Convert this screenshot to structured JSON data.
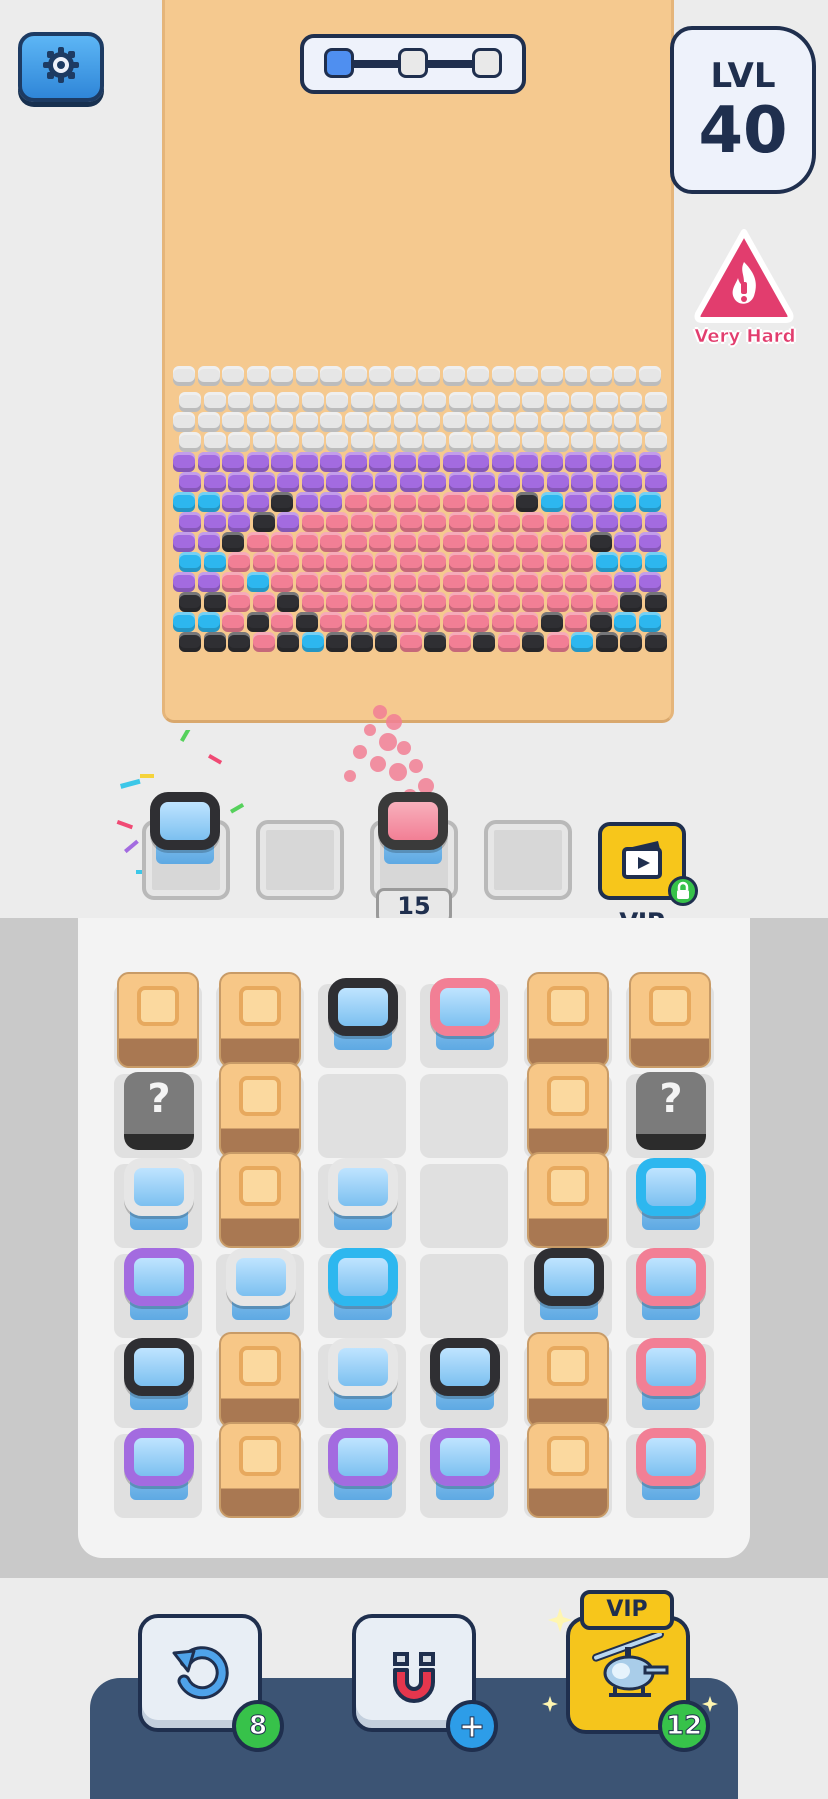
{
  "header": {
    "progress_steps": 3,
    "progress_active_step": 1
  },
  "level": {
    "label": "LVL",
    "number": "40"
  },
  "difficulty": {
    "label": "Very Hard",
    "color": "#e23d6e"
  },
  "colors": {
    "white": "#e6e6e6",
    "purple": "#a36be0",
    "pink": "#f27f95",
    "black": "#2f2f33",
    "blue": "#2db7ef"
  },
  "slots": {
    "filled_count": "15",
    "vip_label": "VIP"
  },
  "board": {
    "rows": [
      [
        "crate",
        "crate",
        "black",
        "pink",
        "crate",
        "crate"
      ],
      [
        "mystery",
        "crate",
        "empty",
        "empty",
        "crate",
        "mystery"
      ],
      [
        "white",
        "crate",
        "white",
        "empty",
        "crate",
        "blue"
      ],
      [
        "purple",
        "white",
        "blue",
        "empty",
        "black",
        "pink"
      ],
      [
        "black",
        "crate",
        "white",
        "black",
        "crate",
        "pink"
      ],
      [
        "purple",
        "crate",
        "purple",
        "purple",
        "crate",
        "pink"
      ]
    ],
    "mystery_symbol": "?"
  },
  "powerups": {
    "undo_count": "8",
    "magnet_badge": "+",
    "heli_count": "12",
    "vip_tag": "VIP"
  }
}
